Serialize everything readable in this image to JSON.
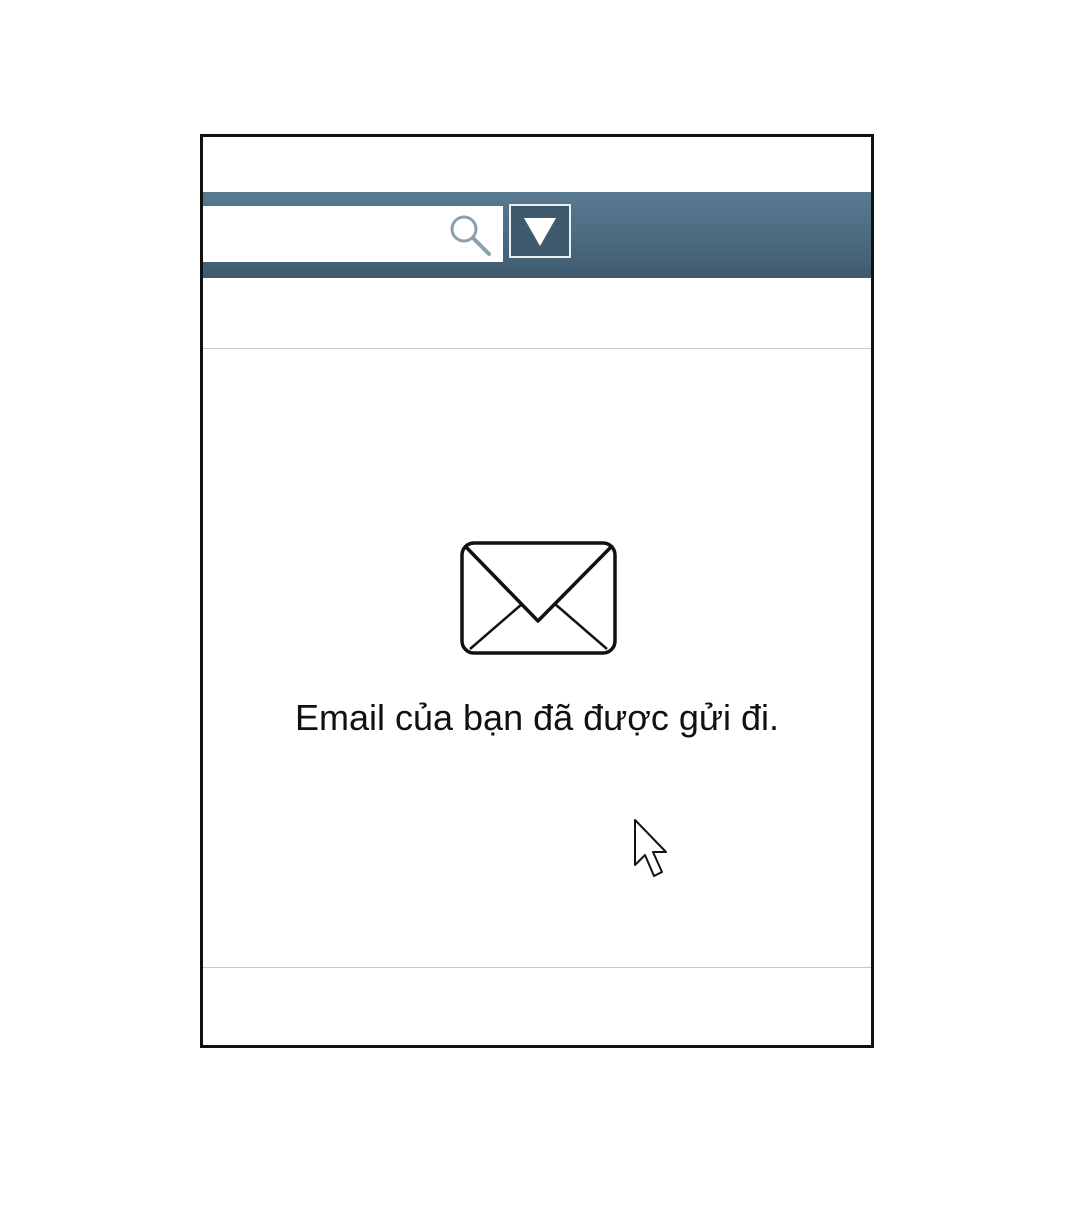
{
  "toolbar": {
    "search": {
      "value": "",
      "placeholder": "",
      "icon": "search-icon"
    },
    "dropdown": {
      "icon": "triangle-down-icon"
    }
  },
  "main": {
    "icon": "envelope-icon",
    "message": "Email của bạn đã được gửi đi."
  },
  "colors": {
    "toolbar": "#4b6a80",
    "toolbar_dark": "#3f5a6d",
    "border": "#111111",
    "divider": "#c8c8c8",
    "search_icon": "#8aa0ae"
  },
  "cursor": {
    "icon": "mouse-pointer-icon"
  }
}
